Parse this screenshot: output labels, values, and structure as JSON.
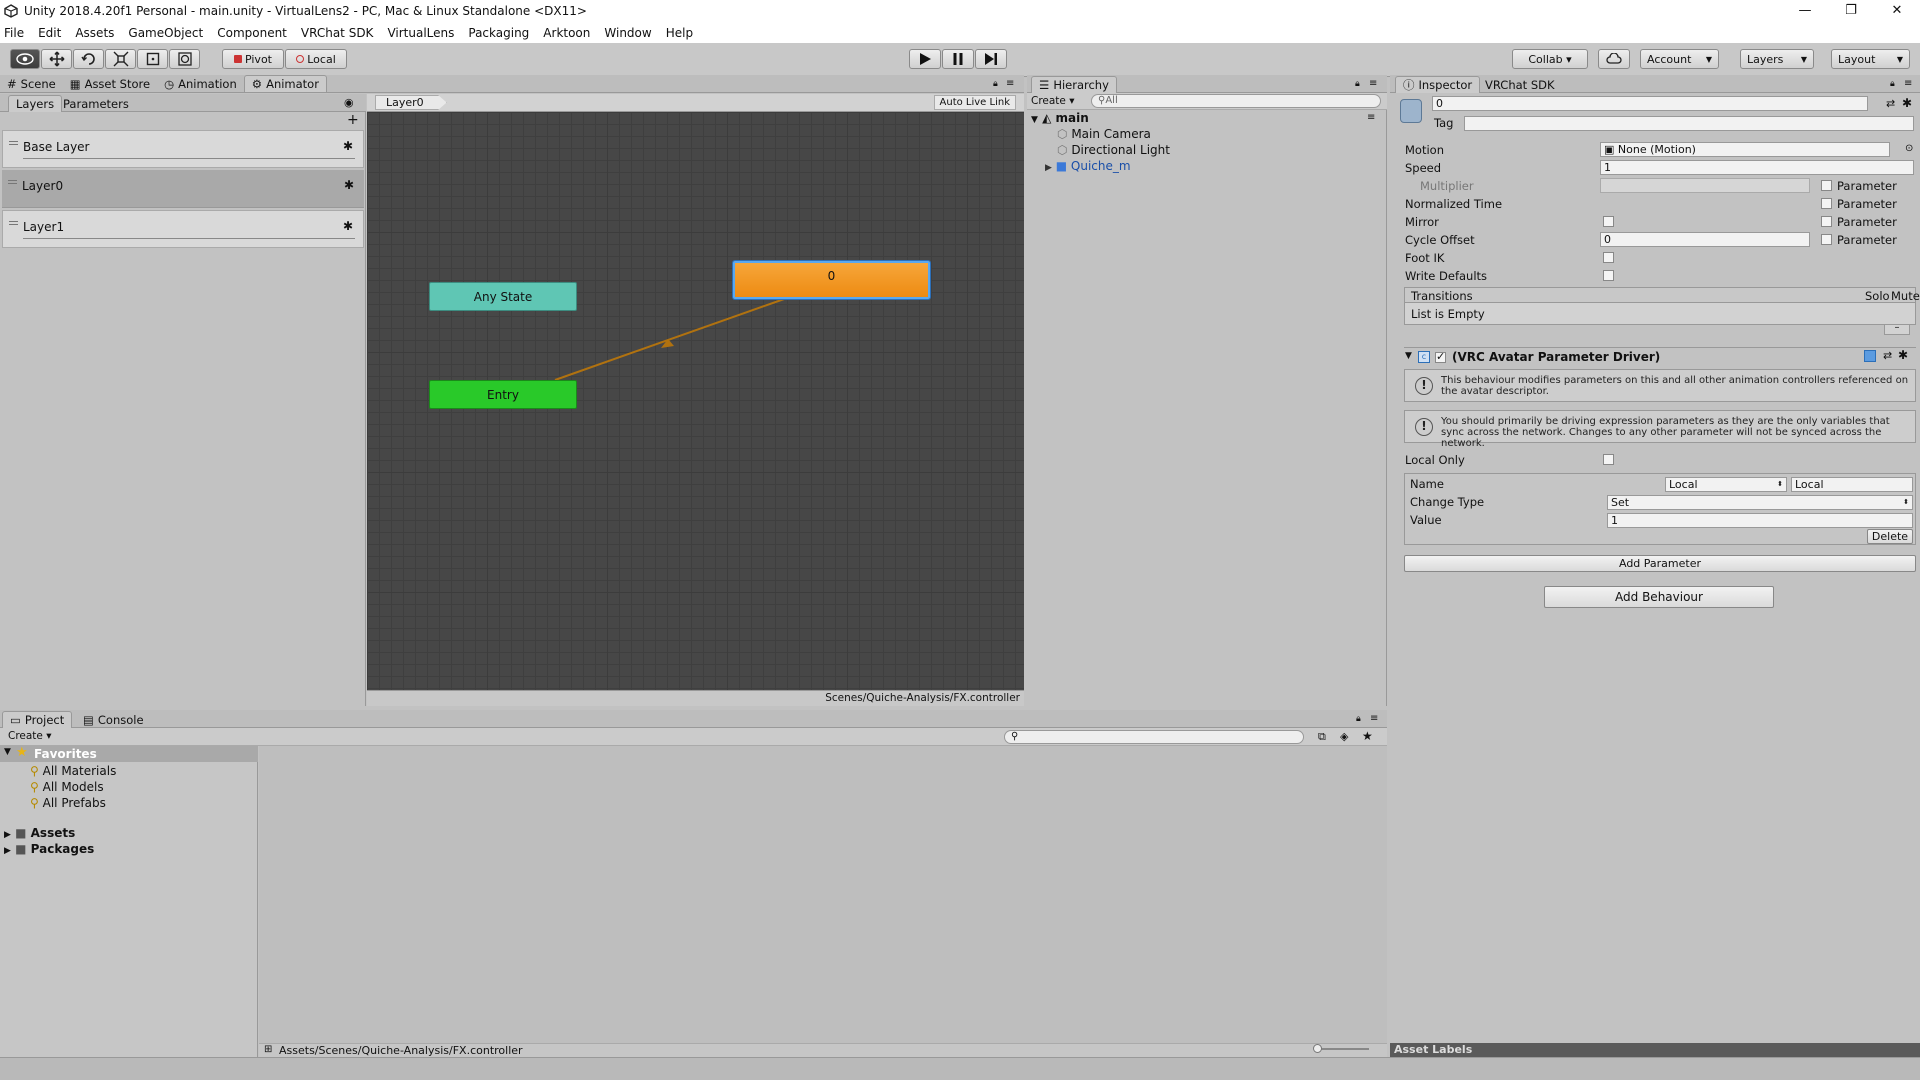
{
  "window": {
    "title": "Unity 2018.4.20f1 Personal - main.unity - VirtualLens2 - PC, Mac & Linux Standalone <DX11>",
    "minimize": "—",
    "restore": "❐",
    "close": "✕"
  },
  "menu": [
    "File",
    "Edit",
    "Assets",
    "GameObject",
    "Component",
    "VRChat SDK",
    "VirtualLens",
    "Packaging",
    "Arktoon",
    "Window",
    "Help"
  ],
  "toolbar": {
    "pivot": "Pivot",
    "local": "Local",
    "collab": "Collab ▾",
    "account": "Account",
    "layers": "Layers",
    "layout": "Layout"
  },
  "scene_tabs": [
    "Scene",
    "Asset Store",
    "Animation",
    "Animator"
  ],
  "animator": {
    "tabs": [
      "Layers",
      "Parameters"
    ],
    "layers": [
      "Base Layer",
      "Layer0",
      "Layer1"
    ],
    "breadcrumb": "Layer0",
    "auto_live_link": "Auto Live Link",
    "nodes": {
      "any_state": "Any State",
      "entry": "Entry",
      "state": "0"
    },
    "footer_path": "Scenes/Quiche-Analysis/FX.controller"
  },
  "hierarchy": {
    "tab": "Hierarchy",
    "create": "Create",
    "search_placeholder": "All",
    "scene": "main",
    "items": [
      "Main Camera",
      "Directional Light",
      "Quiche_m"
    ]
  },
  "inspector": {
    "tabs": [
      "Inspector",
      "VRChat SDK"
    ],
    "name_value": "0",
    "tag_label": "Tag",
    "motion_label": "Motion",
    "motion_value": "None (Motion)",
    "speed_label": "Speed",
    "speed_value": "1",
    "multiplier_label": "Multiplier",
    "normalized_time_label": "Normalized Time",
    "mirror_label": "Mirror",
    "cycle_offset_label": "Cycle Offset",
    "cycle_offset_value": "0",
    "foot_ik_label": "Foot IK",
    "write_defaults_label": "Write Defaults",
    "parameter_label": "Parameter",
    "transitions_label": "Transitions",
    "solo_label": "Solo",
    "mute_label": "Mute",
    "list_empty": "List is Empty",
    "component_title": "(VRC Avatar Parameter Driver)",
    "help1": "This behaviour modifies parameters on this and all other animation controllers referenced on the avatar descriptor.",
    "help2": "You should primarily be driving expression parameters as they are the only variables that sync across the network. Changes to any other parameter will not be synced across the network.",
    "local_only_label": "Local Only",
    "name_label": "Name",
    "name_dropdown": "Local",
    "name_field": "Local",
    "change_type_label": "Change Type",
    "change_type_value": "Set",
    "value_label": "Value",
    "value_value": "1",
    "delete_button": "Delete",
    "add_parameter": "Add Parameter",
    "add_behaviour": "Add Behaviour",
    "asset_labels": "Asset Labels"
  },
  "project": {
    "tabs": [
      "Project",
      "Console"
    ],
    "create": "Create",
    "favorites": "Favorites",
    "favorite_items": [
      "All Materials",
      "All Models",
      "All Prefabs"
    ],
    "folders": [
      "Assets",
      "Packages"
    ],
    "footer_path": "Assets/Scenes/Quiche-Analysis/FX.controller"
  },
  "colors": {
    "state_orange": "#f39c1e",
    "any_state": "#5fc6b4",
    "entry": "#29c929",
    "grid_bg": "#474747",
    "transition": "#b1720f"
  }
}
